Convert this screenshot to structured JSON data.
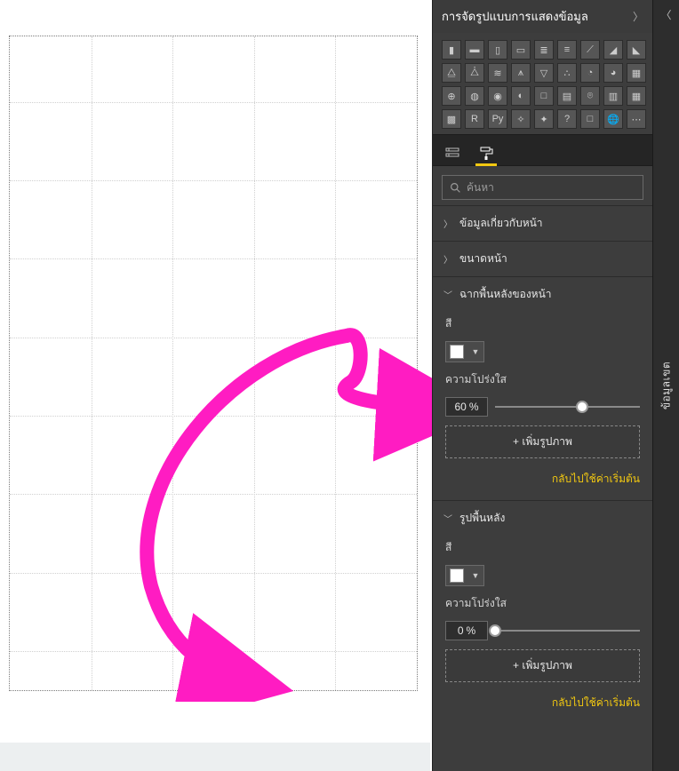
{
  "rail": {
    "label": "ข้อมูลเขต"
  },
  "panel": {
    "title": "การจัดรูปแบบการแสดงข้อมูล",
    "search_placeholder": "ค้นหา"
  },
  "sections": {
    "pageInfo": {
      "title": "ข้อมูลเกี่ยวกับหน้า"
    },
    "pageSize": {
      "title": "ขนาดหน้า"
    },
    "pageBackground": {
      "title": "ฉากพื้นหลังของหน้า",
      "color_label": "สี",
      "color_value": "#ffffff",
      "transparency_label": "ความโปร่งใส",
      "transparency_value": "60",
      "transparency_unit": "%",
      "add_image": "+ เพิ่มรูปภาพ",
      "reset": "กลับไปใช้ค่าเริ่มต้น"
    },
    "wallpaper": {
      "title": "รูปพื้นหลัง",
      "color_label": "สี",
      "color_value": "#ffffff",
      "transparency_label": "ความโปร่งใส",
      "transparency_value": "0",
      "transparency_unit": "%",
      "add_image": "+ เพิ่มรูปภาพ",
      "reset": "กลับไปใช้ค่าเริ่มต้น"
    }
  },
  "icons": {
    "search": "search-icon",
    "paint": "paint-roller-icon",
    "fields": "fields-icon"
  },
  "viz_types": [
    "stacked-bar",
    "stacked-column",
    "clustered-bar",
    "clustered-column",
    "100-stacked-bar",
    "100-stacked-column",
    "line",
    "area",
    "stacked-area",
    "line-stacked-column",
    "line-clustered-column",
    "ribbon",
    "waterfall",
    "funnel",
    "scatter",
    "pie",
    "donut",
    "treemap",
    "map",
    "filled-map",
    "shape-map",
    "gauge",
    "card",
    "multi-row-card",
    "kpi",
    "slicer",
    "table",
    "matrix",
    "r-visual",
    "python-visual",
    "key-influencers",
    "decomposition-tree",
    "qa",
    "paginated",
    "arcgis",
    "more"
  ]
}
